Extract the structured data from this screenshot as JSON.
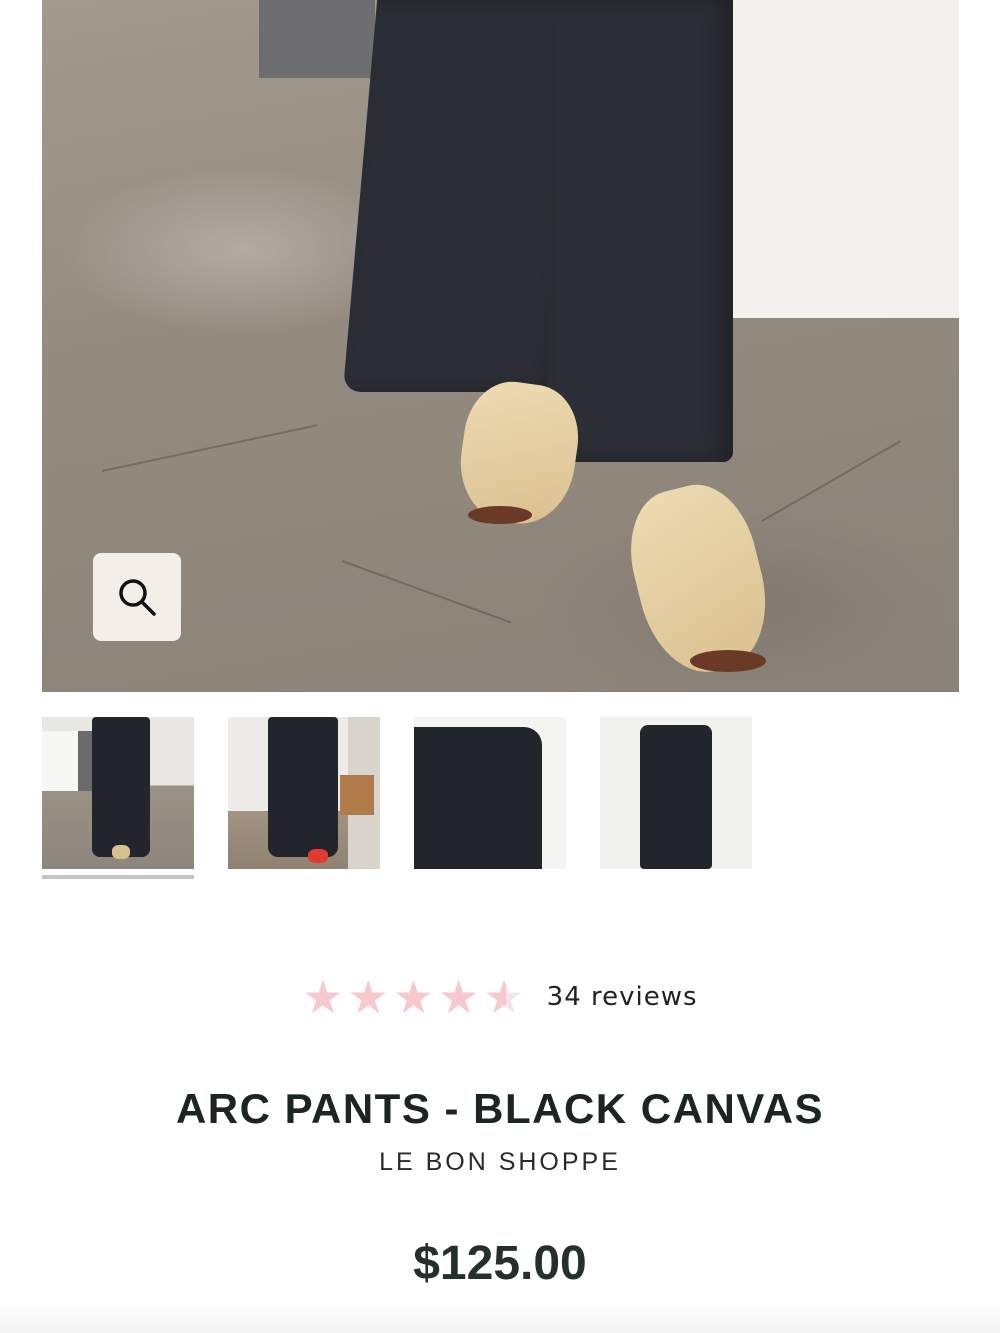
{
  "product": {
    "title": "ARC PANTS - BLACK CANVAS",
    "brand": "LE BON SHOPPE",
    "price": "$125.00"
  },
  "rating": {
    "value": 4.5,
    "max": 5,
    "reviews_label": "34 reviews",
    "star_color": "#f7c9ce"
  },
  "gallery": {
    "main_image": "model-wearing-black-canvas-pants-with-beige-shoes",
    "zoom_icon": "search-icon",
    "thumbnails": [
      {
        "name": "model-front-beige-shoes",
        "selected": true
      },
      {
        "name": "model-front-red-shoes",
        "selected": false
      },
      {
        "name": "waistband-detail",
        "selected": false
      },
      {
        "name": "flat-lay-pants",
        "selected": false
      }
    ]
  },
  "colors": {
    "text_dark": "#1c2520",
    "zoom_bg": "#f3eee8"
  }
}
